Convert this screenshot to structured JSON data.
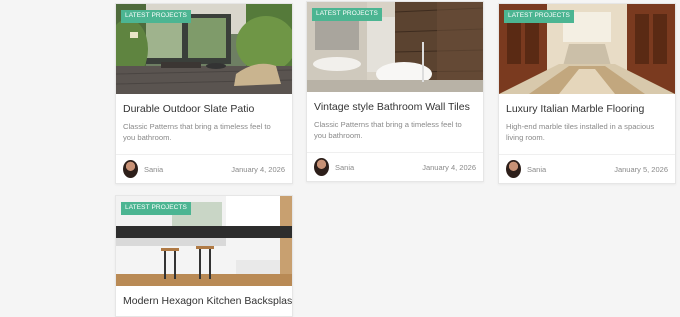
{
  "cards": [
    {
      "badge": "LATEST PROJECTS",
      "title": "Durable Outdoor Slate Patio",
      "description": "Classic Patterns that bring a timeless feel to you bathroom.",
      "author": "Sania",
      "date": "January 4, 2026",
      "image": "patio-photo"
    },
    {
      "badge": "LATEST PROJECTS",
      "title": "Vintage style Bathroom Wall Tiles",
      "description": "Classic Patterns that bring a timeless feel to you bathroom.",
      "author": "Sania",
      "date": "January 4, 2026",
      "image": "bathroom-photo"
    },
    {
      "badge": "LATEST PROJECTS",
      "title": "Luxury Italian Marble Flooring",
      "description": "High-end marble tiles installed in a spacious living room.",
      "author": "Sania",
      "date": "January 5, 2026",
      "image": "marble-hall-photo"
    },
    {
      "badge": "LATEST PROJECTS",
      "title": "Modern Hexagon Kitchen Backsplash",
      "image": "kitchen-photo"
    }
  ],
  "colors": {
    "badge": "#4cb592",
    "page_background": "#f5f5f5"
  }
}
